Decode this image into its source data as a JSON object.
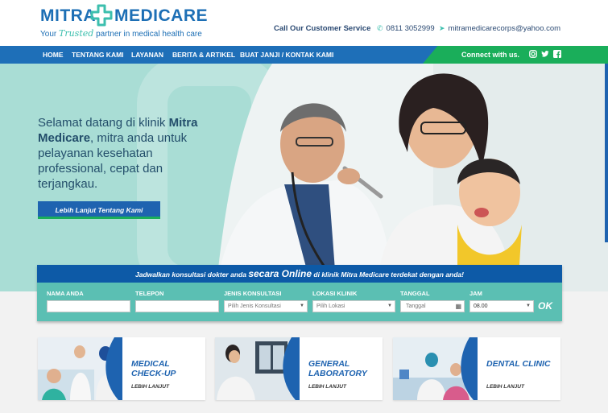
{
  "brand": {
    "word_left": "MITRA",
    "word_right": "MEDICARE",
    "tag_pre": "Your",
    "tag_trusted": "Trusted",
    "tag_post": "partner in medical health care",
    "colors": {
      "blue": "#1d6fb5",
      "green": "#1aae5a",
      "teal": "#3cbfae"
    }
  },
  "contact": {
    "label": "Call Our Customer Service",
    "phone_icon": "phone-icon",
    "phone": "0811 3052999",
    "email_icon": "paper-plane-icon",
    "email": "mitramedicarecorps@yahoo.com"
  },
  "nav": {
    "items": [
      "HOME",
      "TENTANG KAMI",
      "LAYANAN",
      "BERITA & ARTIKEL",
      "BUAT JANJI / KONTAK KAMI"
    ],
    "connect": "Connect with us.",
    "social": [
      "instagram-icon",
      "twitter-icon",
      "facebook-icon"
    ]
  },
  "hero": {
    "welcome_pre": "Selamat datang di klinik",
    "welcome_brand": "Mitra Medicare",
    "welcome_post": ", mitra anda untuk pelayanan kesehatan professional, cepat dan terjangkau.",
    "button": "Lebih Lanjut Tentang Kami"
  },
  "booking": {
    "head_pre": "Jadwalkan konsultasi dokter anda",
    "head_big": "secara Online",
    "head_post": "di klinik Mitra Medicare terdekat dengan anda!",
    "fields": {
      "name_label": "NAMA ANDA",
      "phone_label": "TELEPON",
      "type_label": "JENIS KONSULTASI",
      "type_value": "Pilih Jenis Konsultasi",
      "location_label": "LOKASI KLINIK",
      "location_value": "Pilih Lokasi",
      "date_label": "TANGGAL",
      "date_placeholder": "Tanggal",
      "time_label": "JAM",
      "time_value": "08.00"
    },
    "submit": "OK"
  },
  "cards": [
    {
      "title": "MEDICAL CHECK-UP",
      "more": "LEBIH LANJUT"
    },
    {
      "title": "GENERAL LABORATORY",
      "more": "LEBIH LANJUT"
    },
    {
      "title": "DENTAL CLINIC",
      "more": "LEBIH LANJUT"
    }
  ]
}
